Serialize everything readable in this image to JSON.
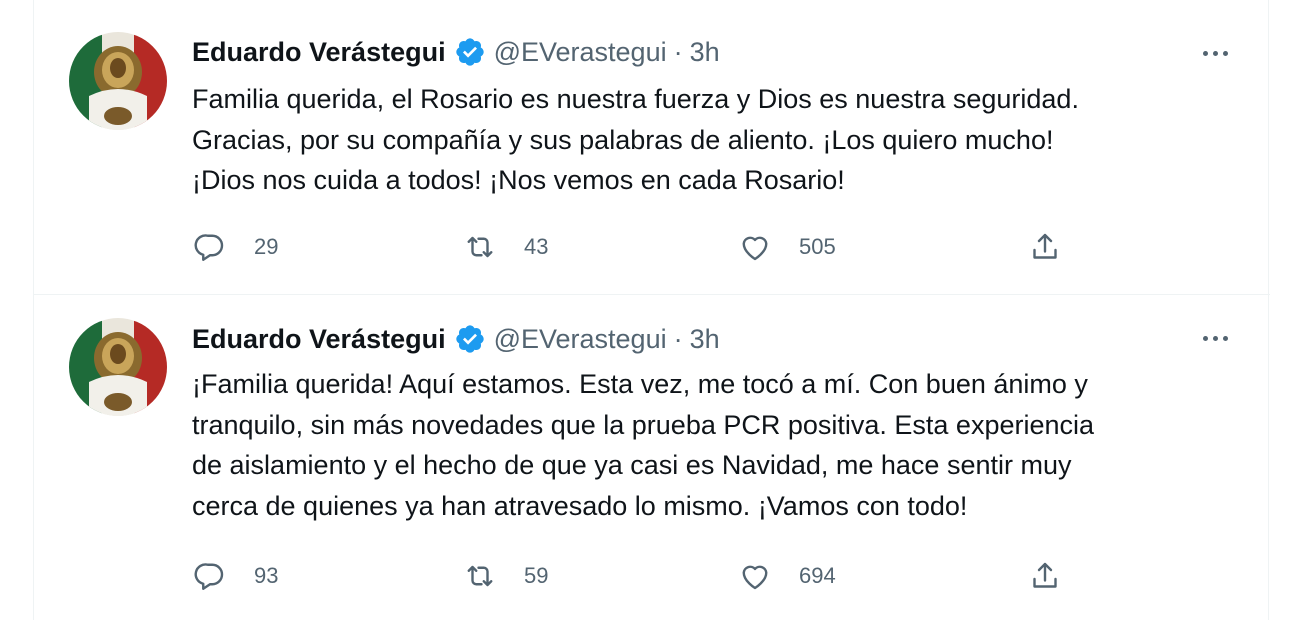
{
  "colors": {
    "accent": "#1d9bf0",
    "text": "#0f1419",
    "muted": "#536471",
    "border": "#eff3f4"
  },
  "tweets": [
    {
      "author_name": "Eduardo Verástegui",
      "handle": "@EVerastegui",
      "separator": "·",
      "time": "3h",
      "lines": [
        "Familia querida, el Rosario es nuestra fuerza y Dios es nuestra seguridad.",
        "Gracias, por su compañía y sus palabras de aliento. ¡Los quiero mucho!",
        "¡Dios nos cuida a todos! ¡Nos vemos en cada Rosario!"
      ],
      "replies": "29",
      "retweets": "43",
      "likes": "505"
    },
    {
      "author_name": "Eduardo Verástegui",
      "handle": "@EVerastegui",
      "separator": "·",
      "time": "3h",
      "lines": [
        "¡Familia querida! Aquí estamos. Esta vez, me tocó a mí. Con buen ánimo y",
        "tranquilo, sin más novedades que la prueba PCR positiva. Esta experiencia",
        "de aislamiento y el hecho de que ya casi es Navidad, me hace sentir muy",
        "cerca de quienes ya han atravesado lo mismo. ¡Vamos con todo!"
      ],
      "replies": "93",
      "retweets": "59",
      "likes": "694"
    }
  ],
  "icons": {
    "verified": "verified-badge-icon",
    "more": "more-icon",
    "reply": "reply-icon",
    "retweet": "retweet-icon",
    "like": "like-icon",
    "share": "share-icon"
  }
}
